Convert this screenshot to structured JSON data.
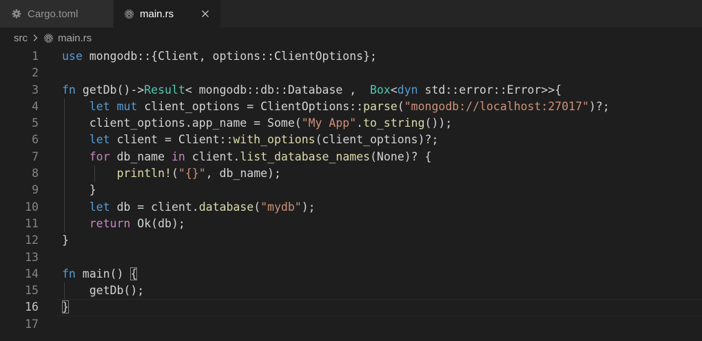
{
  "tabs": [
    {
      "label": "Cargo.toml",
      "icon": "gear-icon",
      "active": false
    },
    {
      "label": "main.rs",
      "icon": "rust-icon",
      "active": true,
      "close": "close-icon"
    }
  ],
  "breadcrumb": {
    "folder": "src",
    "file": "main.rs"
  },
  "editor": {
    "line_numbers": [
      "1",
      "2",
      "3",
      "4",
      "5",
      "6",
      "7",
      "8",
      "9",
      "10",
      "11",
      "12",
      "13",
      "14",
      "15",
      "16",
      "17"
    ],
    "current_line": 16,
    "lines": [
      "use mongodb::{Client, options::ClientOptions};",
      "",
      "fn getDb()->Result< mongodb::db::Database ,  Box<dyn std::error::Error>>{",
      "    let mut client_options = ClientOptions::parse(\"mongodb://localhost:27017\")?;",
      "    client_options.app_name = Some(\"My App\".to_string());",
      "    let client = Client::with_options(client_options)?;",
      "    for db_name in client.list_database_names(None)? {",
      "        println!(\"{}\", db_name);",
      "    }",
      "    let db = client.database(\"mydb\");",
      "    return Ok(db);",
      "}",
      "",
      "fn main() {",
      "    getDb();",
      "}",
      ""
    ]
  },
  "colors": {
    "background": "#1e1e1e",
    "keyword": "#569cd6",
    "control": "#c586c0",
    "type": "#4ec9b0",
    "function": "#dcdcaa",
    "string": "#ce9178",
    "variable": "#9cdcfe",
    "text": "#d4d4d4",
    "line_number": "#858585"
  }
}
